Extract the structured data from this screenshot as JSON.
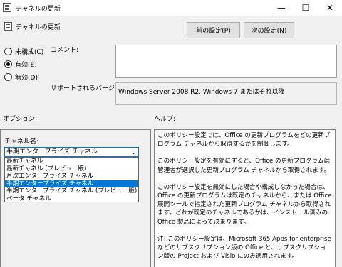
{
  "window": {
    "title": "チャネルの更新",
    "minimize": "—",
    "maximize": "☐",
    "close": "✕"
  },
  "header": {
    "title": "チャネルの更新",
    "prev_button": "前の設定(P)",
    "next_button": "次の設定(N)"
  },
  "state": {
    "not_configured": "未構成(C)",
    "enabled": "有効(E)",
    "disabled": "無効(D)",
    "selected": "enabled"
  },
  "comment": {
    "label": "コメント:",
    "value": ""
  },
  "supported": {
    "label": "サポートされるバージョン:",
    "value": "Windows Server 2008 R2, Windows 7 またはそれ以降"
  },
  "options": {
    "label": "オプション:",
    "channel_label": "チャネル名:",
    "selected_value": "半期エンタープライズ チャネル",
    "dropdown_items": [
      "最新チャネル",
      "最新チャネル (プレビュー版)",
      "月次エンタープライズ チャネル",
      "半期エンタープライズ チャネル",
      "半期エンタープライズ チャネル (プレビュー版)",
      "ベータ チャネル"
    ],
    "highlighted_index": 3
  },
  "help": {
    "label": "ヘルプ:",
    "paragraphs": [
      "このポリシー設定では、Office の更新プログラムをどの更新プログラム チャネルから取得するかを制御します。",
      "このポリシー設定を有効にすると、Office の更新プログラムは管理者が選択した更新プログラム チャネルから取得されます。",
      "このポリシー設定を無効にした場合や構成しなかった場合は、Office の更新プログラムは既定のチャネルから、または Office 展開ツールで指定された更新プログラム チャネルから取得されます。どれが既定のチャネルであるかは、インストール済みの Office 製品によって決まります。",
      "注: このポリシー設定は、Microsoft 365 Apps for enterprise などのサブスクリプション版の Office と、サブスクリプション版の Project および Visio にのみ適用されます。"
    ]
  }
}
